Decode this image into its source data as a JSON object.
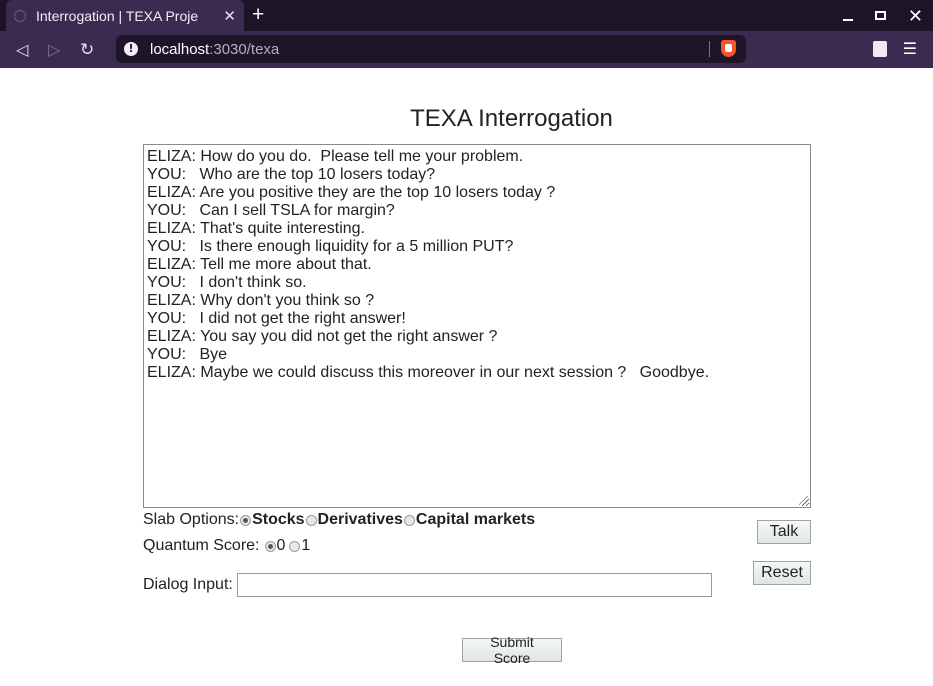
{
  "browser": {
    "tab_title": "Interrogation | TEXA Proje",
    "tab_close": "✕",
    "new_tab": "+",
    "url_host": "localhost",
    "url_path": ":3030/texa",
    "info_glyph": "!",
    "icons": [
      "back-icon",
      "forward-icon",
      "reload-icon",
      "brave-shield-icon",
      "extension-icon",
      "menu-icon"
    ]
  },
  "page": {
    "title": "TEXA Interrogation",
    "conversation": [
      "ELIZA: How do you do.  Please tell me your problem.",
      "YOU:   Who are the top 10 losers today?",
      "ELIZA: Are you positive they are the top 10 losers today ?",
      "YOU:   Can I sell TSLA for margin?",
      "ELIZA: That's quite interesting.",
      "YOU:   Is there enough liquidity for a 5 million PUT?",
      "ELIZA: Tell me more about that.",
      "YOU:   I don't think so.",
      "ELIZA: Why don't you think so ?",
      "YOU:   I did not get the right answer!",
      "ELIZA: You say you did not get the right answer ?",
      "YOU:   Bye",
      "ELIZA: Maybe we could discuss this moreover in our next session ?   Goodbye."
    ],
    "slab": {
      "label": "Slab Options:",
      "options": [
        "Stocks",
        "Derivatives",
        "Capital markets"
      ],
      "selected": "Stocks"
    },
    "quantum": {
      "label": "Quantum Score:",
      "options": [
        "0",
        "1"
      ],
      "selected": "0"
    },
    "dialog": {
      "label": "Dialog Input:",
      "value": ""
    },
    "buttons": {
      "talk": "Talk",
      "reset": "Reset",
      "submit": "Submit Score"
    }
  }
}
